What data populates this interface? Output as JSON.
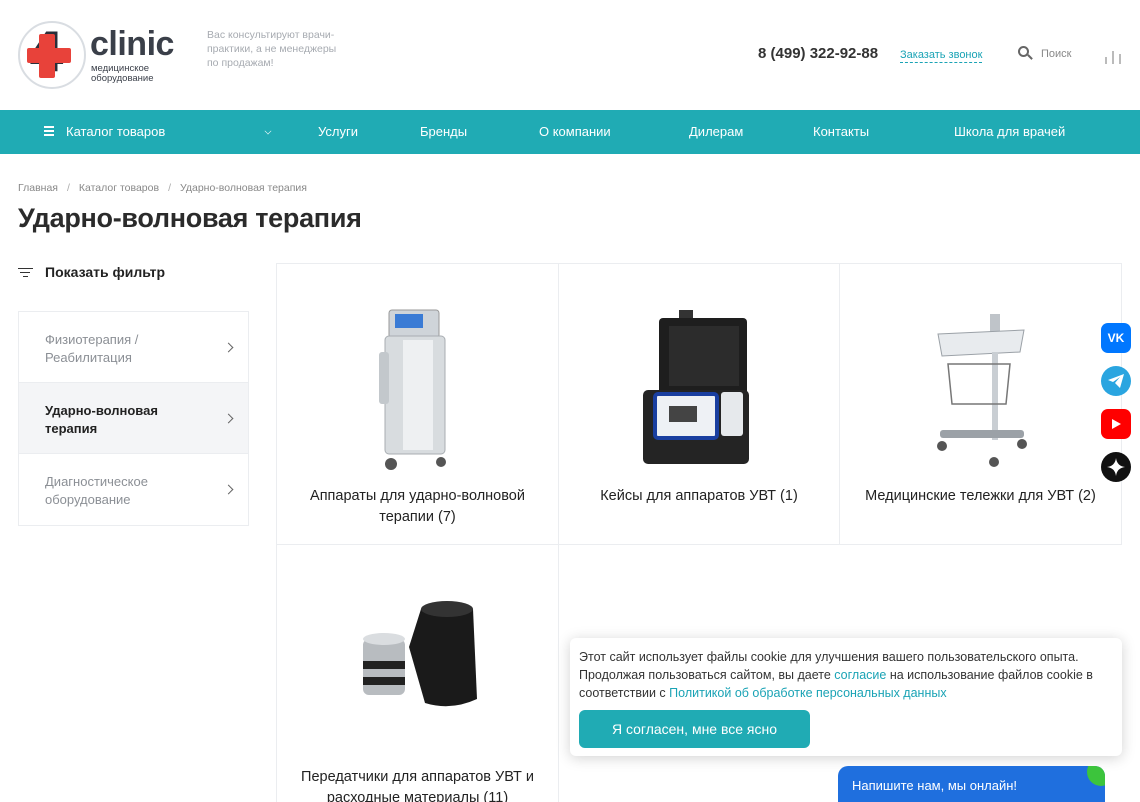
{
  "brand": {
    "logo_word": "clinic",
    "logo_sub": "медицинское оборудование",
    "tagline": "Вас консультируют врачи-практики, а не менеджеры по продажам!"
  },
  "header": {
    "phone": "8 (499) 322-92-88",
    "callback": "Заказать звонок",
    "search_label": "Поиск"
  },
  "nav": {
    "catalog": "Каталог товаров",
    "items": [
      "Услуги",
      "Бренды",
      "О компании",
      "Дилерам",
      "Контакты",
      "Школа для врачей"
    ]
  },
  "breadcrumb": [
    "Главная",
    "Каталог товаров",
    "Ударно-волновая терапия"
  ],
  "page_title": "Ударно-волновая терапия",
  "filter": {
    "label": "Показать фильтр"
  },
  "sidebar": {
    "items": [
      {
        "label": "Физиотерапия / Реабилитация",
        "active": false
      },
      {
        "label": "Ударно-волновая терапия",
        "active": true
      },
      {
        "label": "Диагностическое оборудование",
        "active": false
      }
    ]
  },
  "products": [
    {
      "label": "Аппараты для ударно-волновой терапии (7)",
      "icon": "shockwave-device-image"
    },
    {
      "label": "Кейсы для аппаратов УВТ (1)",
      "icon": "device-case-image"
    },
    {
      "label": "Медицинские тележки для УВТ (2)",
      "icon": "medical-cart-image"
    },
    {
      "label": "Передатчики для аппаратов УВТ и расходные материалы (11)",
      "icon": "transmitter-image"
    }
  ],
  "social": [
    {
      "name": "vk-icon",
      "text": "VK",
      "color": "#0077ff"
    },
    {
      "name": "telegram-icon",
      "text": "",
      "color": "#2aa5e0"
    },
    {
      "name": "youtube-icon",
      "text": "",
      "color": "#ff0000"
    },
    {
      "name": "sparkle-icon",
      "text": "",
      "color": "#111111"
    }
  ],
  "cookie": {
    "text_1": "Этот сайт использует файлы cookie для улучшения вашего пользовательского опыта. Продолжая пользоваться сайтом, вы даете ",
    "link_1": "согласие",
    "text_2": " на использование файлов cookie в соответствии с ",
    "link_2": "Политикой об обработке персональных данных",
    "button": "Я согласен, мне все ясно"
  },
  "chat": {
    "label": "Напишите нам, мы онлайн!"
  },
  "colors": {
    "accent": "#20abb4",
    "logo_red": "#e8423a",
    "chat_blue": "#1f6fde"
  }
}
